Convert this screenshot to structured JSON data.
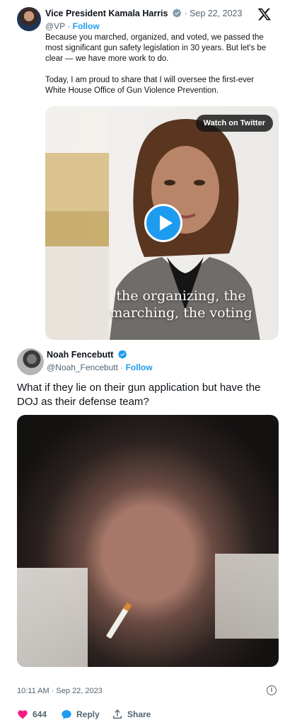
{
  "quoted": {
    "name": "Vice President Kamala Harris",
    "separator": " · ",
    "date": "Sep 22, 2023",
    "handle": "@VP",
    "handle_sep": " · ",
    "follow": "Follow",
    "text_p1": "Because you marched, organized, and voted, we passed the most significant gun safety legislation in 30 years. But let's be clear — we have more work to do.",
    "text_p2": "Today, I am proud to share that I will oversee the first-ever White House Office of Gun Violence Prevention.",
    "video": {
      "watch_label": "Watch on Twitter",
      "caption_line1": "the organizing, the",
      "caption_line2": "marching, the voting"
    }
  },
  "tweet": {
    "name": "Noah Fencebutt",
    "handle": "@Noah_Fencebutt",
    "handle_sep": " · ",
    "follow": "Follow",
    "text": "What if they lie on their gun application but have the DOJ as their defense team?",
    "timestamp": "10:11 AM · Sep 22, 2023",
    "info_glyph": "i",
    "likes": "644",
    "reply_label": "Reply",
    "share_label": "Share"
  },
  "colors": {
    "accent": "#1d9bf0",
    "like": "#f91880",
    "muted": "#536471"
  }
}
